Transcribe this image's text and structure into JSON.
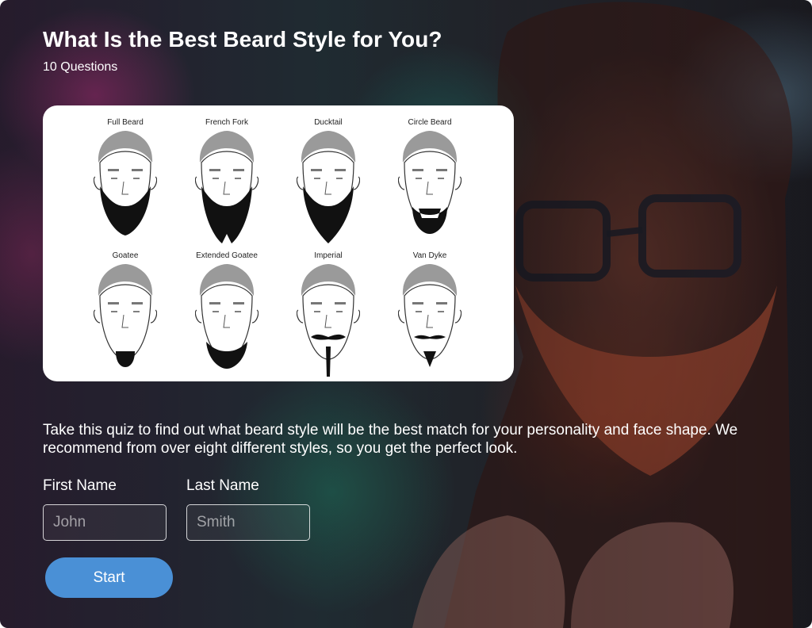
{
  "quiz": {
    "title": "What Is the Best Beard Style for You?",
    "question_count": "10 Questions",
    "description": "Take this quiz to find out what beard style will be the best match for your personality and face shape. We recommend from over eight different styles, so you get the perfect look."
  },
  "beard_styles": [
    "Full Beard",
    "French Fork",
    "Ducktail",
    "Circle Beard",
    "Goatee",
    "Extended Goatee",
    "Imperial",
    "Van Dyke"
  ],
  "form": {
    "first_name": {
      "label": "First Name",
      "placeholder": "John"
    },
    "last_name": {
      "label": "Last Name",
      "placeholder": "Smith"
    },
    "start_label": "Start"
  },
  "colors": {
    "accent": "#4a90d6"
  }
}
